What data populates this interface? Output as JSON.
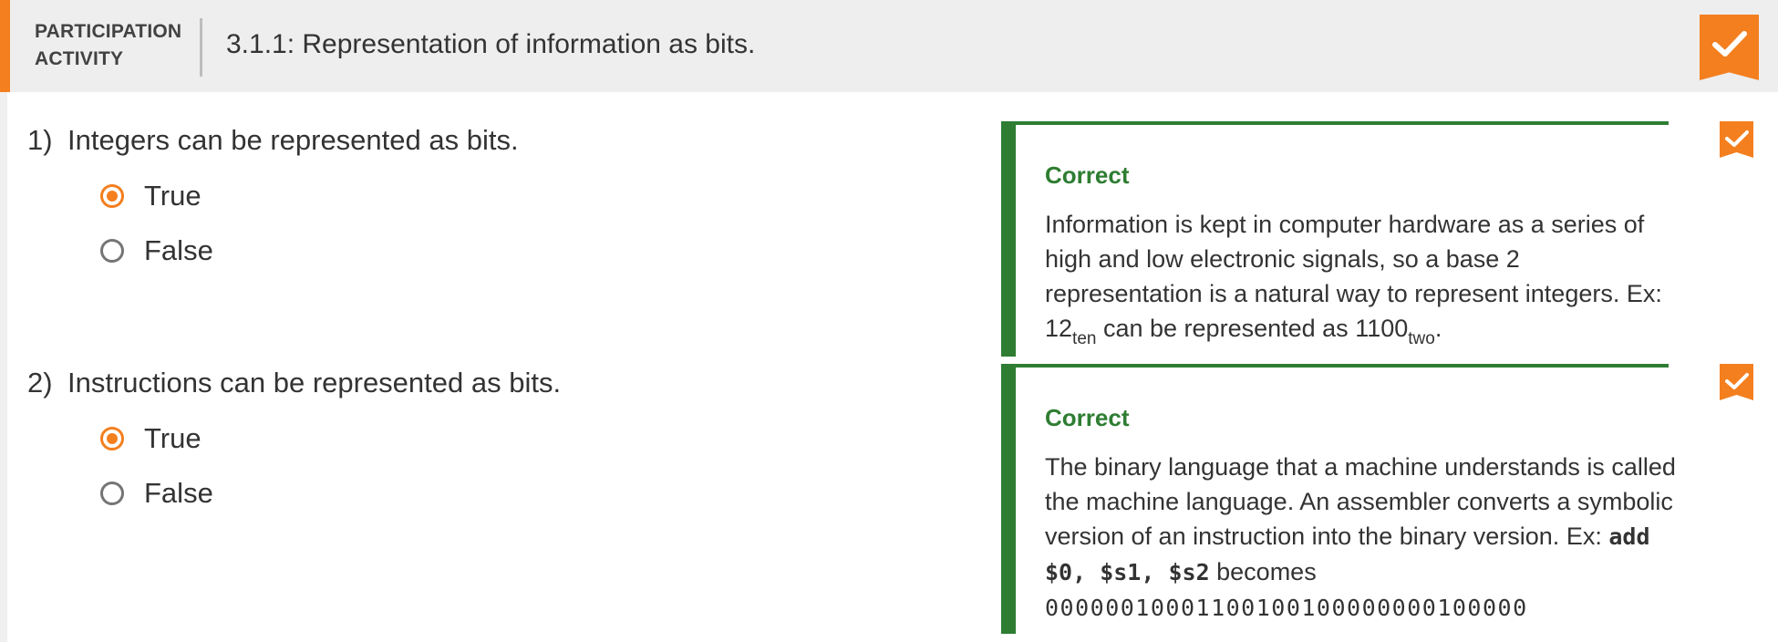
{
  "header": {
    "type_label_line1": "PARTICIPATION",
    "type_label_line2": "ACTIVITY",
    "title": "3.1.1: Representation of information as bits."
  },
  "colors": {
    "accent": "#f47f1f",
    "correct": "#2e7d32",
    "header_bg": "#eeeeee"
  },
  "questions": [
    {
      "number": "1)",
      "text": "Integers can be represented as bits.",
      "choices": [
        {
          "label": "True",
          "selected": true
        },
        {
          "label": "False",
          "selected": false
        }
      ],
      "feedback": {
        "status": "Correct",
        "text": "Information is kept in computer hardware as a series of high and low electronic signals, so a base 2 representation is a natural way to represent integers. Ex:",
        "ex_value1": "12",
        "ex_sub1": "ten",
        "ex_middle": "can be represented as",
        "ex_value2": "1100",
        "ex_sub2": "two",
        "ex_end": "."
      }
    },
    {
      "number": "2)",
      "text": "Instructions can be represented as bits.",
      "choices": [
        {
          "label": "True",
          "selected": true
        },
        {
          "label": "False",
          "selected": false
        }
      ],
      "feedback": {
        "status": "Correct",
        "text": "The binary language that a machine understands is called the machine language. An assembler converts a symbolic version of an instruction into the binary version.",
        "ex_prefix": "Ex:",
        "ex_code": "add $0, $s1, $s2",
        "ex_becomes": "becomes",
        "ex_binary": "00000010001100100100000000100000"
      }
    }
  ]
}
